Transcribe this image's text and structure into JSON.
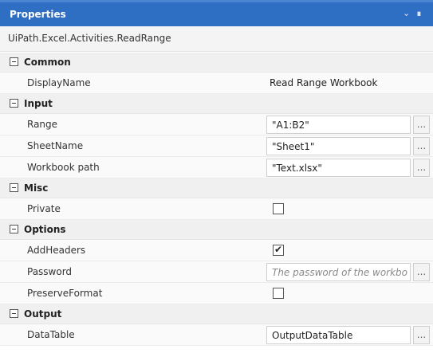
{
  "panel": {
    "title": "Properties",
    "type_name": "UiPath.Excel.Activities.ReadRange"
  },
  "icons": {
    "collapse": "chevron-down-icon",
    "pin": "pin-icon",
    "category_toggle": "minus-box-icon"
  },
  "colors": {
    "titlebar": "#2f6fc3",
    "category_bg": "#f0f0f0"
  },
  "categories": {
    "common": {
      "label": "Common",
      "display_name": {
        "name": "DisplayName",
        "value": "Read Range Workbook"
      }
    },
    "input": {
      "label": "Input",
      "range": {
        "name": "Range",
        "value": "\"A1:B2\""
      },
      "sheet_name": {
        "name": "SheetName",
        "value": "\"Sheet1\""
      },
      "workbook_path": {
        "name": "Workbook path",
        "value": "\"Text.xlsx\""
      }
    },
    "misc": {
      "label": "Misc",
      "private": {
        "name": "Private",
        "checked": false
      }
    },
    "options": {
      "label": "Options",
      "add_headers": {
        "name": "AddHeaders",
        "checked": true
      },
      "password": {
        "name": "Password",
        "placeholder": "The password of the workbo"
      },
      "preserve_format": {
        "name": "PreserveFormat",
        "checked": false
      }
    },
    "output": {
      "label": "Output",
      "data_table": {
        "name": "DataTable",
        "value": "OutputDataTable"
      }
    }
  },
  "ellipsis_label": "..."
}
